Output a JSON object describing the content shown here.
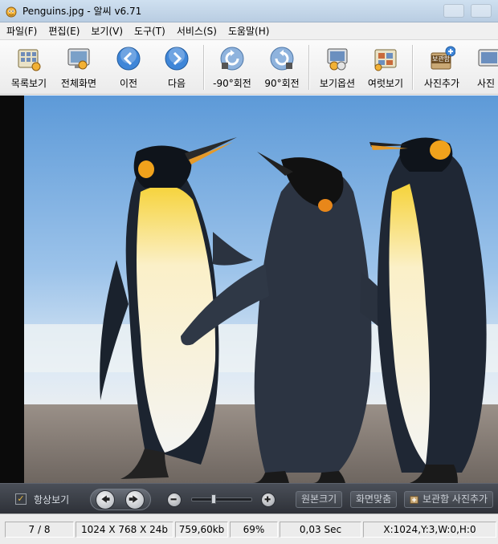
{
  "window": {
    "title": "Penguins.jpg - 알씨 v6.71"
  },
  "menu": [
    "파일(F)",
    "편집(E)",
    "보기(V)",
    "도구(T)",
    "서비스(S)",
    "도움말(H)"
  ],
  "toolbar": {
    "list_view": "목록보기",
    "fullscreen": "전체화면",
    "prev": "이전",
    "next": "다음",
    "rotate_left": "-90°회전",
    "rotate_right": "90°회전",
    "view_options": "보기옵션",
    "open_with": "여럿보기",
    "add_photo": "사진추가",
    "add_photo_badge": "보관함",
    "photo_truncated": "사진"
  },
  "controls": {
    "always_view": "항상보기",
    "original_size": "원본크기",
    "fit_screen": "화면맞춤",
    "add_to_album": "보관함 사진추가",
    "zoom_level": 0.35
  },
  "status": {
    "index": "7 / 8",
    "dimensions": "1024 X 768 X 24b",
    "file_size": "759,60kb",
    "zoom": "69%",
    "load_time": "0,03 Sec",
    "coords": "X:1024,Y:3,W:0,H:0"
  },
  "colors": {
    "toolbar_blue": "#3f86d8",
    "control_bar": "#3a3e45"
  }
}
